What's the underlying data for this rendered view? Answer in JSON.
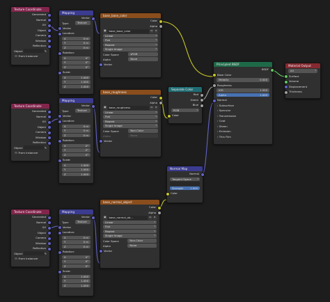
{
  "texcoord": {
    "title": "Texture Coordinate",
    "outputs": [
      "Generated",
      "Normal",
      "UV",
      "Object",
      "Camera",
      "Window",
      "Reflection"
    ],
    "object_label": "Object",
    "from_instancer": "From Instancer"
  },
  "mapping": {
    "title": "Mapping",
    "vector_out": "Vector",
    "type_label": "Type:",
    "type_value": "Texture",
    "vector_in": "Vector",
    "location_label": "Location:",
    "rotation_label": "Rotation:",
    "scale_label": "Scale:",
    "x": "X",
    "y": "Y",
    "z": "Z",
    "loc_value": "0 m",
    "rot_value": "0°",
    "scale_value": "1.000"
  },
  "img1": {
    "title": "base_base_color",
    "image_name": "base_base_color",
    "color_out": "Color",
    "alpha_out": "Alpha",
    "interp": "Linear",
    "proj": "Flat",
    "ext": "Repeat",
    "src": "Single Image",
    "cs_label": "Color Space",
    "cs_value": "sRGB",
    "alpha_label": "Alpha",
    "alpha_value": "None",
    "vector_in": "Vector"
  },
  "img2": {
    "title": "base_roughness",
    "image_name": "base_roughness",
    "color_out": "Color",
    "alpha_out": "Alpha",
    "interp": "Linear",
    "proj": "Flat",
    "ext": "Repeat",
    "src": "Single Image",
    "cs_label": "Color Space",
    "cs_value": "Non-Color",
    "alpha_label": "Alpha",
    "alpha_value": "None",
    "vector_in": "Vector"
  },
  "img3": {
    "title": "base_normal_object",
    "image_name": "base_normal_ob...",
    "color_out": "Color",
    "alpha_out": "Alpha",
    "interp": "Linear",
    "proj": "Flat",
    "ext": "Repeat",
    "src": "Single Image",
    "cs_label": "Color Space",
    "cs_value": "Non-Color",
    "alpha_label": "Alpha",
    "alpha_value": "None",
    "vector_in": "Vector"
  },
  "separate": {
    "title": "Separate Color",
    "outs": [
      "Red",
      "Green",
      "Blue"
    ],
    "mode": "RGB",
    "color_in": "Color"
  },
  "normalmap": {
    "title": "Normal Map",
    "normal_out": "Normal",
    "space": "Tangent Space",
    "strength_label": "Strength",
    "strength_value": "1.000",
    "color_in": "Color"
  },
  "bsdf": {
    "title": "Principled BSDF",
    "bsdf_out": "BSDF",
    "base_color": "Base Color",
    "metallic_label": "Metallic",
    "metallic_value": "0.000",
    "roughness": "Roughness",
    "ior_label": "IOR",
    "ior_value": "1.500",
    "alpha_label": "Alpha",
    "alpha_value": "1.000",
    "normal": "Normal",
    "panels": [
      "Subsurface",
      "Specular",
      "Transmission",
      "Coat",
      "Sheen",
      "Emission",
      "Thin Film"
    ]
  },
  "output": {
    "title": "Material Output",
    "target": "All",
    "inputs": [
      "Surface",
      "Volume",
      "Displacement",
      "Thickness"
    ]
  }
}
